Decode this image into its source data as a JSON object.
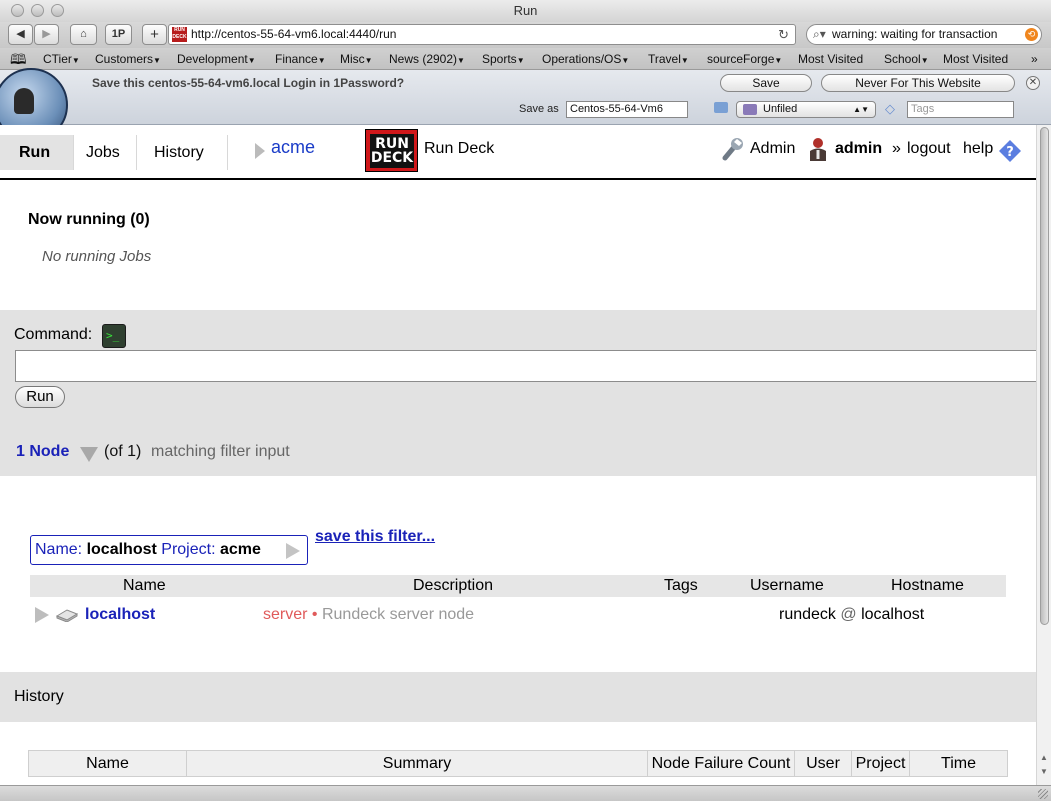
{
  "browser": {
    "window_title": "Run",
    "url": "http://centos-55-64-vm6.local:4440/run",
    "search_text": "warning:  waiting for transaction",
    "toolbar": {
      "onepassword_label": "1P",
      "add_label": "+"
    },
    "bookmarks": [
      "CTier",
      "Customers",
      "Development",
      "Finance",
      "Misc",
      "News (2902)",
      "Sports",
      "Operations/OS",
      "Travel",
      "sourceForge",
      "Most Visited",
      "School",
      "Most Visited"
    ]
  },
  "onepassword": {
    "message": "Save this centos-55-64-vm6.local Login in 1Password?",
    "save_button": "Save",
    "never_button": "Never For This Website",
    "save_as_label": "Save as",
    "save_as_value": "Centos-55-64-Vm6",
    "folder_value": "Unfiled",
    "tags_placeholder": "Tags"
  },
  "nav": {
    "tabs": [
      "Run",
      "Jobs",
      "History"
    ],
    "project": "acme",
    "logo_text": "RUN DECK",
    "app_name": "Run Deck",
    "admin_link": "Admin",
    "user": "admin",
    "separator": "»",
    "logout": "logout",
    "help": "help"
  },
  "now_running": {
    "title": "Now running (0)",
    "empty_text": "No running Jobs"
  },
  "command": {
    "label": "Command:",
    "value": "",
    "run_button": "Run",
    "node_count": "1 Node",
    "node_total": "(of 1)",
    "matching_text": "matching filter input"
  },
  "filter": {
    "name_key": "Name:",
    "name_value": "localhost",
    "project_key": "Project:",
    "project_value": "acme",
    "save_link": "save this filter..."
  },
  "nodes": {
    "columns": [
      "Name",
      "Description",
      "Tags",
      "Username",
      "Hostname"
    ],
    "rows": [
      {
        "name": "localhost",
        "tag": "server",
        "bullet": "•",
        "description": "Rundeck server node",
        "username": "rundeck",
        "at": "@",
        "hostname": "localhost"
      }
    ]
  },
  "history": {
    "title": "History",
    "columns": [
      "Name",
      "Summary",
      "Node Failure Count",
      "User",
      "Project",
      "Time"
    ]
  }
}
